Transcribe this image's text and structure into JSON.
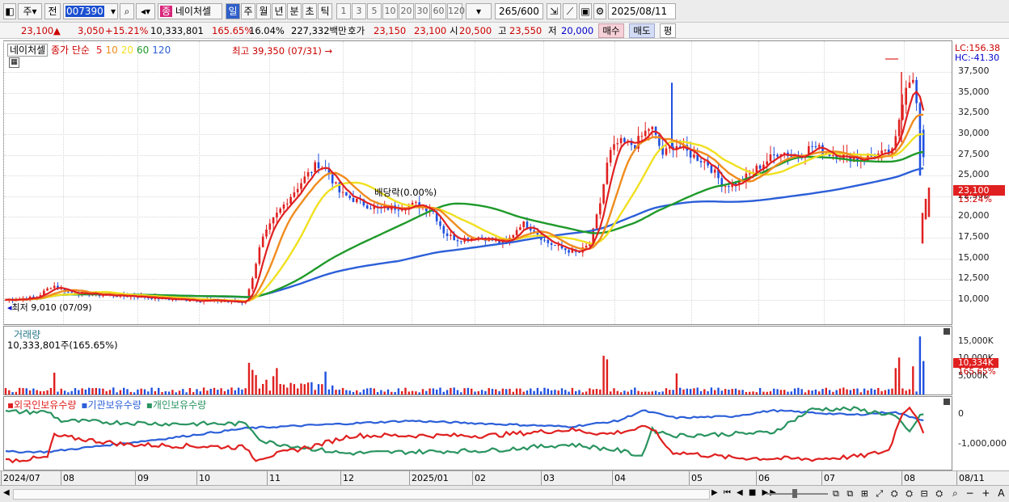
{
  "toolbar": {
    "market": "주",
    "prev": "전",
    "code": "007390",
    "name": "네이처셀",
    "mode_badge": "종",
    "periods": [
      "일",
      "주",
      "월",
      "년",
      "분",
      "초",
      "틱"
    ],
    "minutes": [
      "1",
      "3",
      "5",
      "10",
      "20",
      "30",
      "60",
      "120"
    ],
    "count": "265",
    "total": "/600",
    "date": "2025/08/11"
  },
  "quote": {
    "price": "23,100",
    "change_arrow": "▲",
    "change": "3,050",
    "change_pct": "+15.21%",
    "volume": "10,333,801",
    "vol_ratio": "165.65%",
    "turnover": "16.04%",
    "amount": "227,332백만",
    "ask_label": "호가",
    "ask": "23,150",
    "bid": "23,100",
    "open_label": "시",
    "open": "20,500",
    "high_label": "고",
    "high": "23,550",
    "low_label": "저",
    "low": "20,000",
    "buy": "매수",
    "sell": "매도",
    "eval": "평"
  },
  "price_pane": {
    "name_tag": "네이처셀",
    "ma_label": "종가 단순",
    "ma_periods": [
      "5",
      "10",
      "20",
      "60",
      "120"
    ],
    "lc": "LC:156.38",
    "hc": "HC:-41.30",
    "high_marker": "최고 39,350 (07/31) →",
    "low_marker": "최저 9,010 (07/09)",
    "dividend": "배당락(0.00%)",
    "yticks": [
      "37,500",
      "35,000",
      "32,500",
      "30,000",
      "27,500",
      "25,000",
      "22,500",
      "20,000",
      "17,500",
      "15,000",
      "12,500",
      "10,000"
    ],
    "last_price": "23,100",
    "last_pct": "13.24%"
  },
  "volume_pane": {
    "title": "거래량",
    "value": "10,333,801주(165.65%)",
    "yticks": [
      "15,000K",
      "10,000K",
      "5,000K"
    ],
    "last_value": "10,334K",
    "last_pct": "165.65%"
  },
  "holder_pane": {
    "legend": [
      "외국인보유수량",
      "기관보유수량",
      "개인보유수량"
    ],
    "yticks": [
      "0",
      "-1,000,000"
    ]
  },
  "dates": [
    "2024/07",
    "08",
    "09",
    "10",
    "11",
    "12",
    "2025/01",
    "02",
    "03",
    "04",
    "05",
    "06",
    "07",
    "08",
    "08/11"
  ],
  "colors": {
    "ma5": "#e02020",
    "ma10": "#f08c1e",
    "ma20": "#f0e020",
    "ma60": "#1f9a2a",
    "ma120": "#2c5fd8",
    "up": "#e02020",
    "down": "#2050e0",
    "foreign": "#e02020",
    "inst": "#2c5fd8",
    "indiv": "#2a9460"
  }
}
